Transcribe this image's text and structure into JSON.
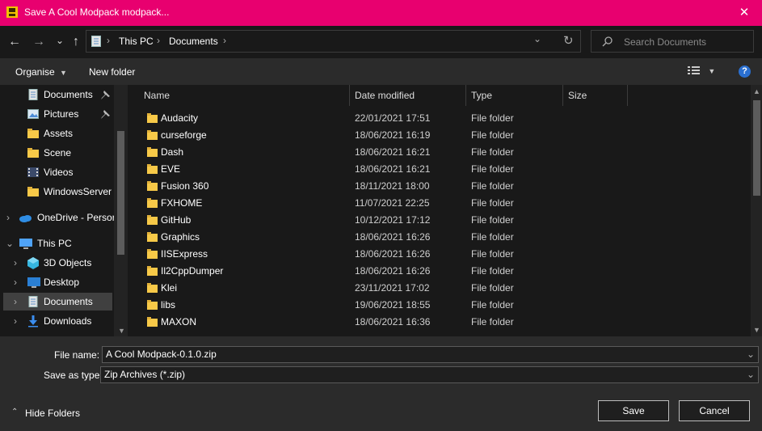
{
  "window": {
    "title": "Save A Cool Modpack modpack...",
    "close_glyph": "✕",
    "accent": "#e8006f"
  },
  "nav": {
    "back_glyph": "←",
    "forward_glyph": "→",
    "recent_glyph": "⌄",
    "up_glyph": "↑",
    "breadcrumb": [
      "This PC",
      "Documents"
    ],
    "sep_glyph": "›",
    "dropdown_glyph": "⌄",
    "refresh_glyph": "↻",
    "search_placeholder": "Search Documents"
  },
  "command_bar": {
    "organise_label": "Organise",
    "new_folder_label": "New folder",
    "help_glyph": "?"
  },
  "tree": {
    "items": [
      {
        "label": "Documents",
        "icon": "documents-icon",
        "pinned": true
      },
      {
        "label": "Pictures",
        "icon": "pictures-icon",
        "pinned": true
      },
      {
        "label": "Assets",
        "icon": "folder-icon",
        "pinned": false
      },
      {
        "label": "Scene",
        "icon": "folder-icon",
        "pinned": false
      },
      {
        "label": "Videos",
        "icon": "videos-icon",
        "pinned": false
      },
      {
        "label": "WindowsServer",
        "icon": "folder-icon",
        "pinned": false
      },
      {
        "label": "OneDrive - Persor",
        "icon": "onedrive-icon",
        "pinned": false
      },
      {
        "label": "This PC",
        "icon": "this-pc-icon",
        "pinned": false
      },
      {
        "label": "3D Objects",
        "icon": "3d-objects-icon",
        "pinned": false
      },
      {
        "label": "Desktop",
        "icon": "desktop-icon",
        "pinned": false
      },
      {
        "label": "Documents",
        "icon": "documents-icon",
        "pinned": false
      },
      {
        "label": "Downloads",
        "icon": "downloads-icon",
        "pinned": false
      }
    ],
    "pin_glyph": "📌",
    "expand_glyph": "›",
    "expanded_glyph": "⌄"
  },
  "columns": {
    "name": "Name",
    "date": "Date modified",
    "type": "Type",
    "size": "Size"
  },
  "files": [
    {
      "name": "Audacity",
      "date": "22/01/2021 17:51",
      "type": "File folder"
    },
    {
      "name": "curseforge",
      "date": "18/06/2021 16:19",
      "type": "File folder"
    },
    {
      "name": "Dash",
      "date": "18/06/2021 16:21",
      "type": "File folder"
    },
    {
      "name": "EVE",
      "date": "18/06/2021 16:21",
      "type": "File folder"
    },
    {
      "name": "Fusion 360",
      "date": "18/11/2021 18:00",
      "type": "File folder"
    },
    {
      "name": "FXHOME",
      "date": "11/07/2021 22:25",
      "type": "File folder"
    },
    {
      "name": "GitHub",
      "date": "10/12/2021 17:12",
      "type": "File folder"
    },
    {
      "name": "Graphics",
      "date": "18/06/2021 16:26",
      "type": "File folder"
    },
    {
      "name": "IISExpress",
      "date": "18/06/2021 16:26",
      "type": "File folder"
    },
    {
      "name": "Il2CppDumper",
      "date": "18/06/2021 16:26",
      "type": "File folder"
    },
    {
      "name": "Klei",
      "date": "23/11/2021 17:02",
      "type": "File folder"
    },
    {
      "name": "libs",
      "date": "19/06/2021 18:55",
      "type": "File folder"
    },
    {
      "name": "MAXON",
      "date": "18/06/2021 16:36",
      "type": "File folder"
    }
  ],
  "bottom": {
    "file_name_label": "File name:",
    "file_name_value": "A Cool Modpack-0.1.0.zip",
    "save_type_label": "Save as type:",
    "save_type_value": "Zip Archives (*.zip)",
    "hide_folders_label": "Hide Folders",
    "save_label": "Save",
    "cancel_label": "Cancel"
  }
}
